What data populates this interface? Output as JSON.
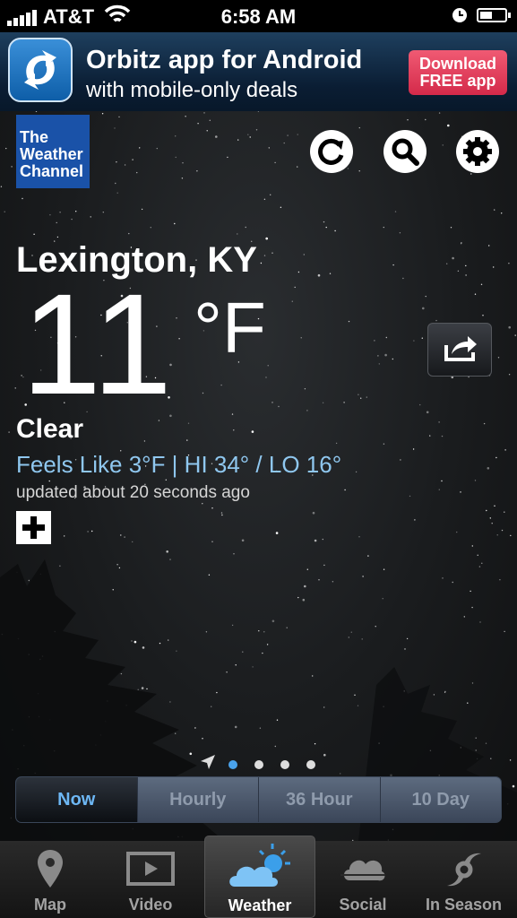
{
  "status_bar": {
    "carrier": "AT&T",
    "time": "6:58 AM"
  },
  "ad": {
    "title": "Orbitz app for Android",
    "subtitle": "with mobile-only deals",
    "cta_line1": "Download",
    "cta_line2": "FREE app"
  },
  "header": {
    "logo_line1": "The",
    "logo_line2": "Weather",
    "logo_line3": "Channel"
  },
  "weather": {
    "location": "Lexington, KY",
    "temperature": "11",
    "unit": "°F",
    "condition": "Clear",
    "feels_like": "Feels Like 3°F | HI 34° / LO 16°",
    "updated": "updated about 20 seconds ago"
  },
  "pager": {
    "pages": 4,
    "active_index": 0
  },
  "segments": [
    {
      "label": "Now",
      "active": true
    },
    {
      "label": "Hourly",
      "active": false
    },
    {
      "label": "36 Hour",
      "active": false
    },
    {
      "label": "10 Day",
      "active": false
    }
  ],
  "tabs": [
    {
      "label": "Map",
      "icon": "map-pin-icon"
    },
    {
      "label": "Video",
      "icon": "video-icon"
    },
    {
      "label": "Weather",
      "icon": "weather-icon",
      "active": true
    },
    {
      "label": "Social",
      "icon": "social-icon"
    },
    {
      "label": "In Season",
      "icon": "hurricane-icon"
    }
  ],
  "colors": {
    "accent_blue": "#6db7f4",
    "feels_like_blue": "#8fc7ef",
    "twc_blue": "#1a52a8",
    "ad_button": "#e0405e"
  }
}
